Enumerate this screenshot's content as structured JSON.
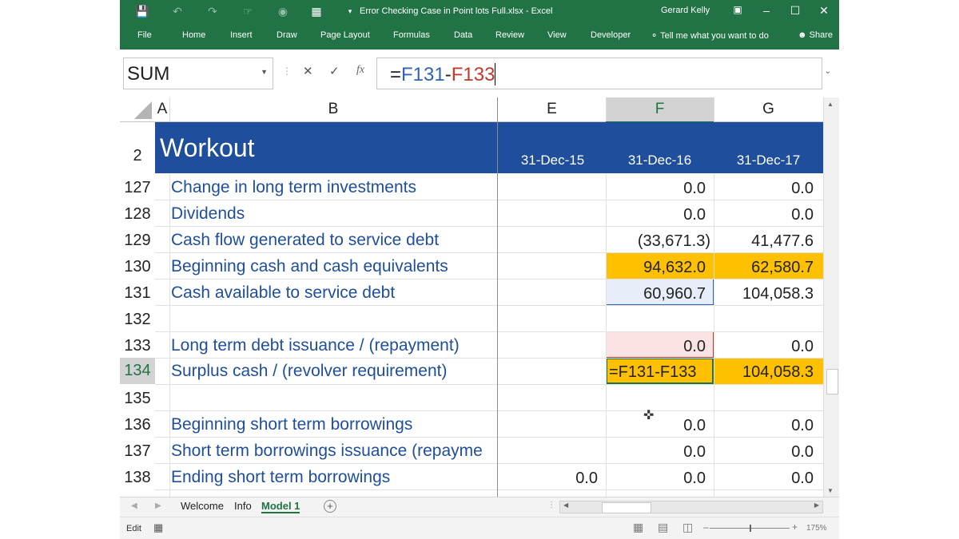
{
  "titlebar": {
    "document_title": "Error Checking Case in Point lots Full.xlsx  -  Excel",
    "user": "Gerard Kelly"
  },
  "ribbon_tabs": [
    "File",
    "Home",
    "Insert",
    "Draw",
    "Page Layout",
    "Formulas",
    "Data",
    "Review",
    "View",
    "Developer"
  ],
  "tell_me": "Tell me what you want to do",
  "share": "Share",
  "formula_bar": {
    "name_box": "SUM",
    "formula_prefix": "=",
    "ref1": "F131",
    "operator": "-",
    "ref2": "F133"
  },
  "columns": [
    "A",
    "B",
    "E",
    "F",
    "G"
  ],
  "header_row": {
    "row_number": "2",
    "title": "Workout",
    "dates": [
      "31-Dec-15",
      "31-Dec-16",
      "31-Dec-17"
    ]
  },
  "rows": [
    {
      "row": "127",
      "label": "Change in long term investments",
      "e": "",
      "f": "0.0",
      "g": "0.0"
    },
    {
      "row": "128",
      "label": "Dividends",
      "e": "",
      "f": "0.0",
      "g": "0.0"
    },
    {
      "row": "129",
      "label": "Cash flow generated to service debt",
      "e": "",
      "f": "(33,671.3)",
      "g": "41,477.6"
    },
    {
      "row": "130",
      "label": "Beginning cash and cash equivalents",
      "e": "",
      "f": "94,632.0",
      "g": "62,580.7"
    },
    {
      "row": "131",
      "label": "Cash available to service debt",
      "e": "",
      "f": "60,960.7",
      "g": "104,058.3"
    },
    {
      "row": "132",
      "label": "",
      "e": "",
      "f": "",
      "g": ""
    },
    {
      "row": "133",
      "label": "Long term debt issuance / (repayment)",
      "e": "",
      "f": "0.0",
      "g": "0.0"
    },
    {
      "row": "134",
      "label": "Surplus cash / (revolver requirement)",
      "e": "",
      "f": "=F131-F133",
      "g": "104,058.3"
    },
    {
      "row": "135",
      "label": "",
      "e": "",
      "f": "",
      "g": ""
    },
    {
      "row": "136",
      "label": "Beginning short term borrowings",
      "e": "",
      "f": "0.0",
      "g": "0.0"
    },
    {
      "row": "137",
      "label": "Short term borrowings issuance (repayme",
      "e": "",
      "f": "0.0",
      "g": "0.0"
    },
    {
      "row": "138",
      "label": "Ending short term borrowings",
      "e": "0.0",
      "f": "0.0",
      "g": "0.0"
    }
  ],
  "sheet_tabs": [
    "Welcome",
    "Info",
    "Model 1"
  ],
  "active_sheet": "Model 1",
  "status": {
    "mode": "Edit",
    "zoom": "175%"
  },
  "colors": {
    "excel_green": "#217346",
    "header_blue": "#1f4e9c",
    "highlight_orange": "#ffc000",
    "ref1_blue": "#2e63b8",
    "ref2_red": "#c0392b"
  }
}
